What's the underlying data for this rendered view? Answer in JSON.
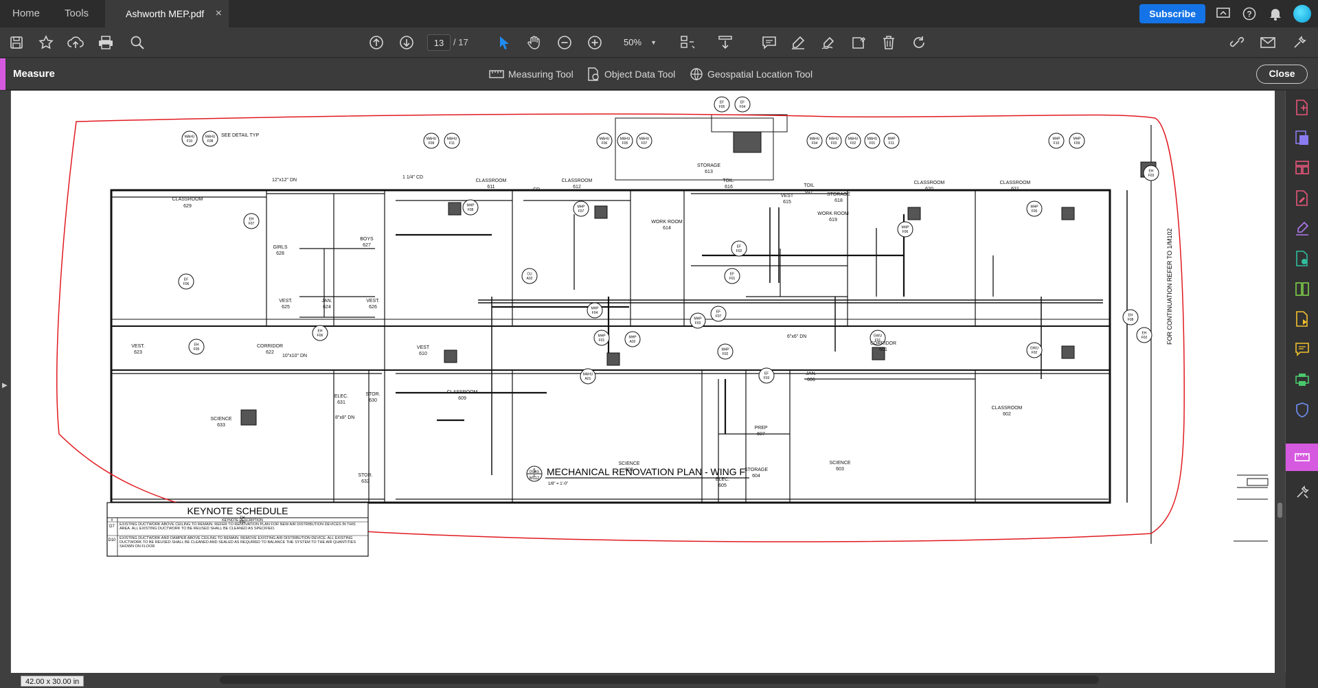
{
  "tabs": {
    "home": "Home",
    "tools": "Tools",
    "document": "Ashworth MEP.pdf",
    "close_glyph": "×"
  },
  "header": {
    "subscribe": "Subscribe"
  },
  "toolbar": {
    "current_page": "13",
    "total_pages": "/ 17",
    "zoom": "50%"
  },
  "measure": {
    "title": "Measure",
    "tools": [
      "Measuring Tool",
      "Object Data Tool",
      "Geospatial Location Tool"
    ],
    "close": "Close"
  },
  "drawing": {
    "title": "MECHANICAL RENOVATION PLAN - WING F",
    "scale": "1/8\" = 1'-0\"",
    "detail_no": "1",
    "detail_sheet": "M112",
    "continuation": "FOR CONTINUATION REFER TO 1/M102",
    "rooms": [
      {
        "label": "CLASSROOM",
        "num": "629"
      },
      {
        "label": "GIRLS",
        "num": "628"
      },
      {
        "label": "BOYS",
        "num": "627"
      },
      {
        "label": "VEST.",
        "num": "625"
      },
      {
        "label": "JAN.",
        "num": "624"
      },
      {
        "label": "VEST.",
        "num": "626"
      },
      {
        "label": "VEST.",
        "num": "623"
      },
      {
        "label": "CORRIDOR",
        "num": "622"
      },
      {
        "label": "SCIENCE",
        "num": "633"
      },
      {
        "label": "ELEC.",
        "num": "631"
      },
      {
        "label": "STOR.",
        "num": "630"
      },
      {
        "label": "STOR.",
        "num": "632"
      },
      {
        "label": "CLASSROOM",
        "num": "611"
      },
      {
        "label": "CLASSROOM",
        "num": "612"
      },
      {
        "label": "VEST",
        "num": "610"
      },
      {
        "label": "CLASSROOM",
        "num": "609"
      },
      {
        "label": "SCIENCE",
        "num": "608"
      },
      {
        "label": "STORAGE",
        "num": "613"
      },
      {
        "label": "TOIL.",
        "num": "616"
      },
      {
        "label": "WORK ROOM",
        "num": "614"
      },
      {
        "label": "VEST",
        "num": "615"
      },
      {
        "label": "TOIL",
        "num": "617"
      },
      {
        "label": "STORAGE",
        "num": "618"
      },
      {
        "label": "WORK ROOM",
        "num": "619"
      },
      {
        "label": "JAN.",
        "num": "606"
      },
      {
        "label": "PREP",
        "num": "607"
      },
      {
        "label": "STORAGE",
        "num": "604"
      },
      {
        "label": "ELEC.",
        "num": "605"
      },
      {
        "label": "SCIENCE",
        "num": "603"
      },
      {
        "label": "CLASSROOM",
        "num": "620"
      },
      {
        "label": "CLASSROOM",
        "num": "621"
      },
      {
        "label": "CORRIDOR",
        "num": "601"
      },
      {
        "label": "CLASSROOM",
        "num": "602"
      }
    ],
    "equipment_tags": [
      "MAHU F10",
      "MAHU F08",
      "MAHU F09",
      "MAHU F11",
      "MAHU F06",
      "MAHU F05",
      "MAHU F07",
      "MAHU F04",
      "MAHU F03",
      "MAHU F02",
      "MAHU F01",
      "MHP F11",
      "MHP F10",
      "MHP F09",
      "MHP F08",
      "MHP F07",
      "MHP F06",
      "MHP F05",
      "MHP F04",
      "MHP F03",
      "MHP F02",
      "MHP F01",
      "GWU F01",
      "GWU F02",
      "EH F06",
      "EH F05",
      "EH F07",
      "EH F08",
      "EH F02",
      "EH F03",
      "EH F01",
      "EF F06",
      "EF F07",
      "EF F05",
      "EF F04",
      "EF F03",
      "EF F02",
      "EF F01",
      "CU A02",
      "MHP A02",
      "MAHU A01",
      "DOAS F"
    ],
    "notes": [
      "SEE DETAIL TYP",
      "1 1/4\" CD",
      "CD",
      "12\"x12\" DN",
      "10\"x10\" DN",
      "8\"x8\" DN",
      "6\"x6\" DN"
    ]
  },
  "keynote": {
    "title": "KEYNOTE SCHEDULE",
    "col_num": "#",
    "col_desc": "KEYNOTE DESCRIPTION",
    "rows": [
      {
        "num": "D7",
        "desc": "EXISTING DUCTWORK ABOVE CEILING TO REMAIN. REFER TO RENOVATION PLAN FOR NEW AIR DISTRIBUTION DEVICES IN THIS AREA. ALL EXISTING DUCTWORK TO BE REUSED SHALL BE CLEANED AS SPECIFIED."
      },
      {
        "num": "D10",
        "desc": "EXISTING DUCTWORK AND DAMPER ABOVE CEILING TO REMAIN. REMOVE EXISTING AIR DISTRIBUTION DEVICE. ALL EXISTING DUCTWORK TO BE REUSED SHALL BE CLEANED AND SEALED AS REQUIRED TO BALANCE THE SYSTEM TO THE AIR QUANTITIES SHOWN ON FLOOR"
      }
    ]
  },
  "status": {
    "dimensions": "42.00 x 30.00 in"
  },
  "colors": {
    "accent": "#d65ae0",
    "subscribe": "#1473e6",
    "markup": "#e0191f"
  }
}
